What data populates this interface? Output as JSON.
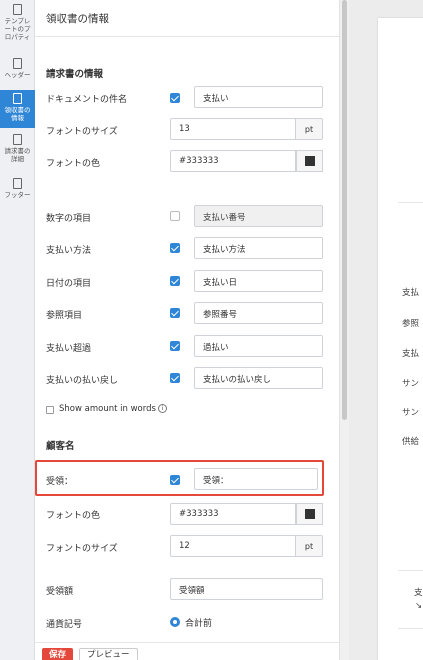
{
  "rail": {
    "items": [
      {
        "label": "テンプレートのプロパティ"
      },
      {
        "label": "ヘッダー"
      },
      {
        "label": "領収書の情報"
      },
      {
        "label": "請求書の詳細"
      },
      {
        "label": "フッター"
      }
    ]
  },
  "panel": {
    "title": "領収書の情報",
    "invoice_section": {
      "title": "請求書の情報",
      "doc_subject": {
        "label": "ドキュメントの件名",
        "checked": true,
        "value": "支払い"
      },
      "font_size": {
        "label": "フォントのサイズ",
        "value": "13",
        "unit": "pt"
      },
      "font_color": {
        "label": "フォントの色",
        "value": "#333333"
      },
      "fields": [
        {
          "label": "数字の項目",
          "checked": false,
          "value": "支払い番号"
        },
        {
          "label": "支払い方法",
          "checked": true,
          "value": "支払い方法"
        },
        {
          "label": "日付の項目",
          "checked": true,
          "value": "支払い日"
        },
        {
          "label": "参照項目",
          "checked": true,
          "value": "参照番号"
        },
        {
          "label": "支払い超過",
          "checked": true,
          "value": "過払い"
        },
        {
          "label": "支払いの払い戻し",
          "checked": true,
          "value": "支払いの払い戻し"
        }
      ],
      "show_words": {
        "label": "Show amount in words",
        "checked": false
      }
    },
    "customer_section": {
      "title": "顧客名",
      "received": {
        "label": "受領：",
        "checked": true,
        "value": "受領："
      },
      "font_color": {
        "label": "フォントの色",
        "value": "#333333"
      },
      "font_size": {
        "label": "フォントのサイズ",
        "value": "12",
        "unit": "pt"
      },
      "received_amount": {
        "label": "受領額",
        "value": "受領額"
      },
      "currency": {
        "label": "通貨記号",
        "option": "合計前"
      }
    },
    "footer": {
      "save": "保存",
      "preview": "プレビュー"
    }
  },
  "preview": {
    "lines": [
      "支払",
      "参照",
      "支払",
      "サン",
      "サン",
      "供給"
    ],
    "bottom_text": "支",
    "bottom_mark": "↘"
  },
  "colors": {
    "accent": "#2f86d6",
    "save": "#e4483a",
    "highlight": "#e4483a",
    "font_swatch": "#333333"
  }
}
